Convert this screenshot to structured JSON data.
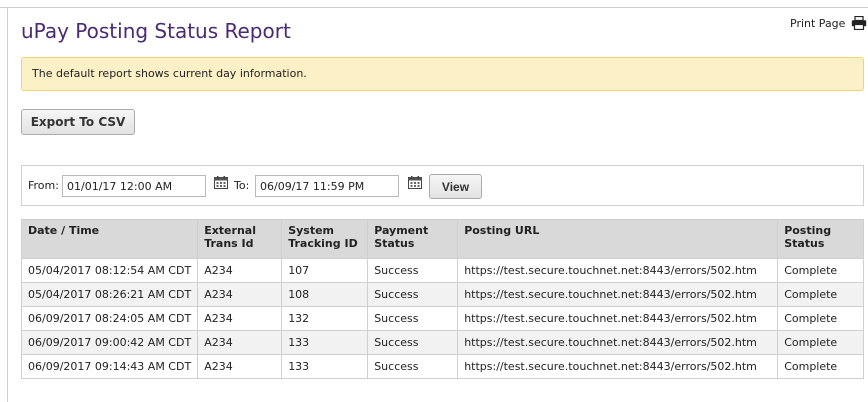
{
  "page": {
    "title": "uPay Posting Status Report",
    "print_label": "Print Page",
    "notice": "The default report shows current day information.",
    "export_label": "Export To CSV"
  },
  "filter": {
    "from_label": "From:",
    "from_value": "01/01/17 12:00 AM",
    "to_label": "To:",
    "to_value": "06/09/17 11:59 PM",
    "view_label": "View"
  },
  "table": {
    "headers": [
      "Date / Time",
      "External Trans Id",
      "System Tracking ID",
      "Payment Status",
      "Posting URL",
      "Posting Status"
    ],
    "header_lines": [
      [
        "Date / Time",
        ""
      ],
      [
        "External",
        "Trans Id"
      ],
      [
        "System",
        "Tracking ID"
      ],
      [
        "Payment",
        "Status"
      ],
      [
        "Posting URL",
        ""
      ],
      [
        "Posting",
        "Status"
      ]
    ],
    "rows": [
      [
        "05/04/2017 08:12:54 AM CDT",
        "A234",
        "107",
        "Success",
        "https://test.secure.touchnet.net:8443/errors/502.htm",
        "Complete"
      ],
      [
        "05/04/2017 08:26:21 AM CDT",
        "A234",
        "108",
        "Success",
        "https://test.secure.touchnet.net:8443/errors/502.htm",
        "Complete"
      ],
      [
        "06/09/2017 08:24:05 AM CDT",
        "A234",
        "132",
        "Success",
        "https://test.secure.touchnet.net:8443/errors/502.htm",
        "Complete"
      ],
      [
        "06/09/2017 09:00:42 AM CDT",
        "A234",
        "133",
        "Success",
        "https://test.secure.touchnet.net:8443/errors/502.htm",
        "Complete"
      ],
      [
        "06/09/2017 09:14:43 AM CDT",
        "A234",
        "133",
        "Success",
        "https://test.secure.touchnet.net:8443/errors/502.htm",
        "Complete"
      ]
    ]
  },
  "icons": {
    "print": "printer-icon",
    "calendar": "calendar-icon"
  },
  "colors": {
    "title": "#4b2a74",
    "notice_bg": "#fcf0c6",
    "notice_border": "#f0d27a",
    "header_bg": "#d9d9d9"
  }
}
